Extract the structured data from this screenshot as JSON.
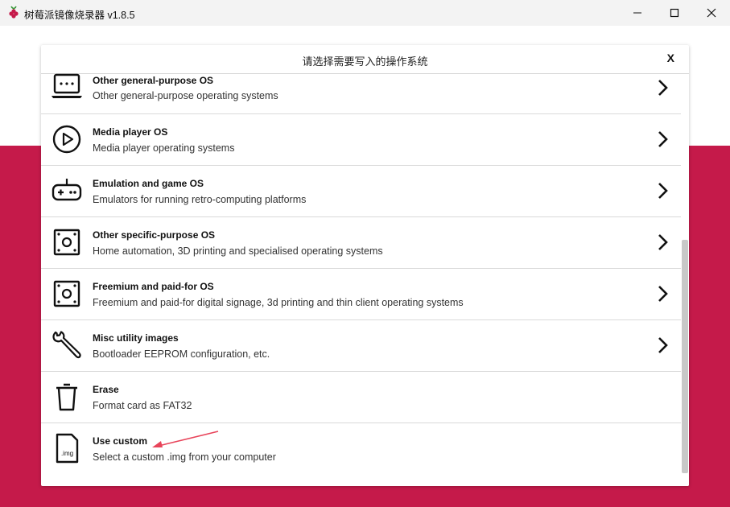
{
  "window": {
    "title": "树莓派镜像烧录器 v1.8.5",
    "minimize_icon": "minimize-icon",
    "maximize_icon": "maximize-icon",
    "close_icon": "close-icon"
  },
  "colors": {
    "brand": "#c51a4a",
    "titlebar": "#f3f3f3",
    "annotation": "#e8445a"
  },
  "dialog": {
    "title": "请选择需要写入的操作系统",
    "close_label": "X",
    "items": [
      {
        "name": "Other general-purpose OS",
        "desc": "Other general-purpose operating systems",
        "icon": "laptop-icon",
        "has_submenu": true
      },
      {
        "name": "Media player OS",
        "desc": "Media player operating systems",
        "icon": "play-icon",
        "has_submenu": true
      },
      {
        "name": "Emulation and game OS",
        "desc": "Emulators for running retro-computing platforms",
        "icon": "gamepad-icon",
        "has_submenu": true
      },
      {
        "name": "Other specific-purpose OS",
        "desc": "Home automation, 3D printing and specialised operating systems",
        "icon": "board-icon",
        "has_submenu": true
      },
      {
        "name": "Freemium and paid-for OS",
        "desc": "Freemium and paid-for digital signage, 3d printing and thin client operating systems",
        "icon": "board-icon",
        "has_submenu": true
      },
      {
        "name": "Misc utility images",
        "desc": "Bootloader EEPROM configuration, etc.",
        "icon": "wrench-icon",
        "has_submenu": true
      },
      {
        "name": "Erase",
        "desc": "Format card as FAT32",
        "icon": "trash-icon",
        "has_submenu": false
      },
      {
        "name": "Use custom",
        "desc": "Select a custom .img from your computer",
        "icon": "img-file-icon",
        "icon_text": ".img",
        "has_submenu": false
      }
    ]
  }
}
